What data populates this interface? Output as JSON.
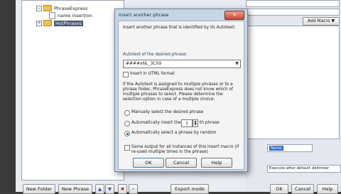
{
  "tree": {
    "root_label": "PhraseExpress",
    "child_label": "name insertion",
    "selected_label": "HotPhrases"
  },
  "toolbar": {
    "new_folder": "New Folder",
    "new_phrase": "New Phrase",
    "export_label": "Export mode",
    "ok": "OK",
    "cancel": "Cancel",
    "help": "Help"
  },
  "right": {
    "add_macro": "Add Macro ▼",
    "none_value": "None",
    "execute_value": "Execute after default delimiter"
  },
  "dialog": {
    "title": "Insert another phrase",
    "close": "✕",
    "intro": "Insert another phrase that is identified by its Autotext:",
    "autotext_label": "Autotext of the desired phrase:",
    "autotext_value": "####xNL_3C09",
    "insert_utml": "Insert in UTML format",
    "info": "If the Autotext is assigned to multiple phrases or to a phrase folder, PhraseExpress does not know which of multiple phrases to select. Please determine the selection option in case of a multiple choice:",
    "opt_manual": "Manually select the desired phrase",
    "opt_auto_prefix": "Automatically insert the",
    "opt_auto_num": "1",
    "opt_auto_suffix": "th phrase",
    "opt_random": "Automatically select a phrase by random",
    "same_output": "Same output for all instances of this insert macro (if re-used multiple times in the phrase)",
    "ok": "OK",
    "cancel": "Cancel",
    "help": "Help"
  }
}
